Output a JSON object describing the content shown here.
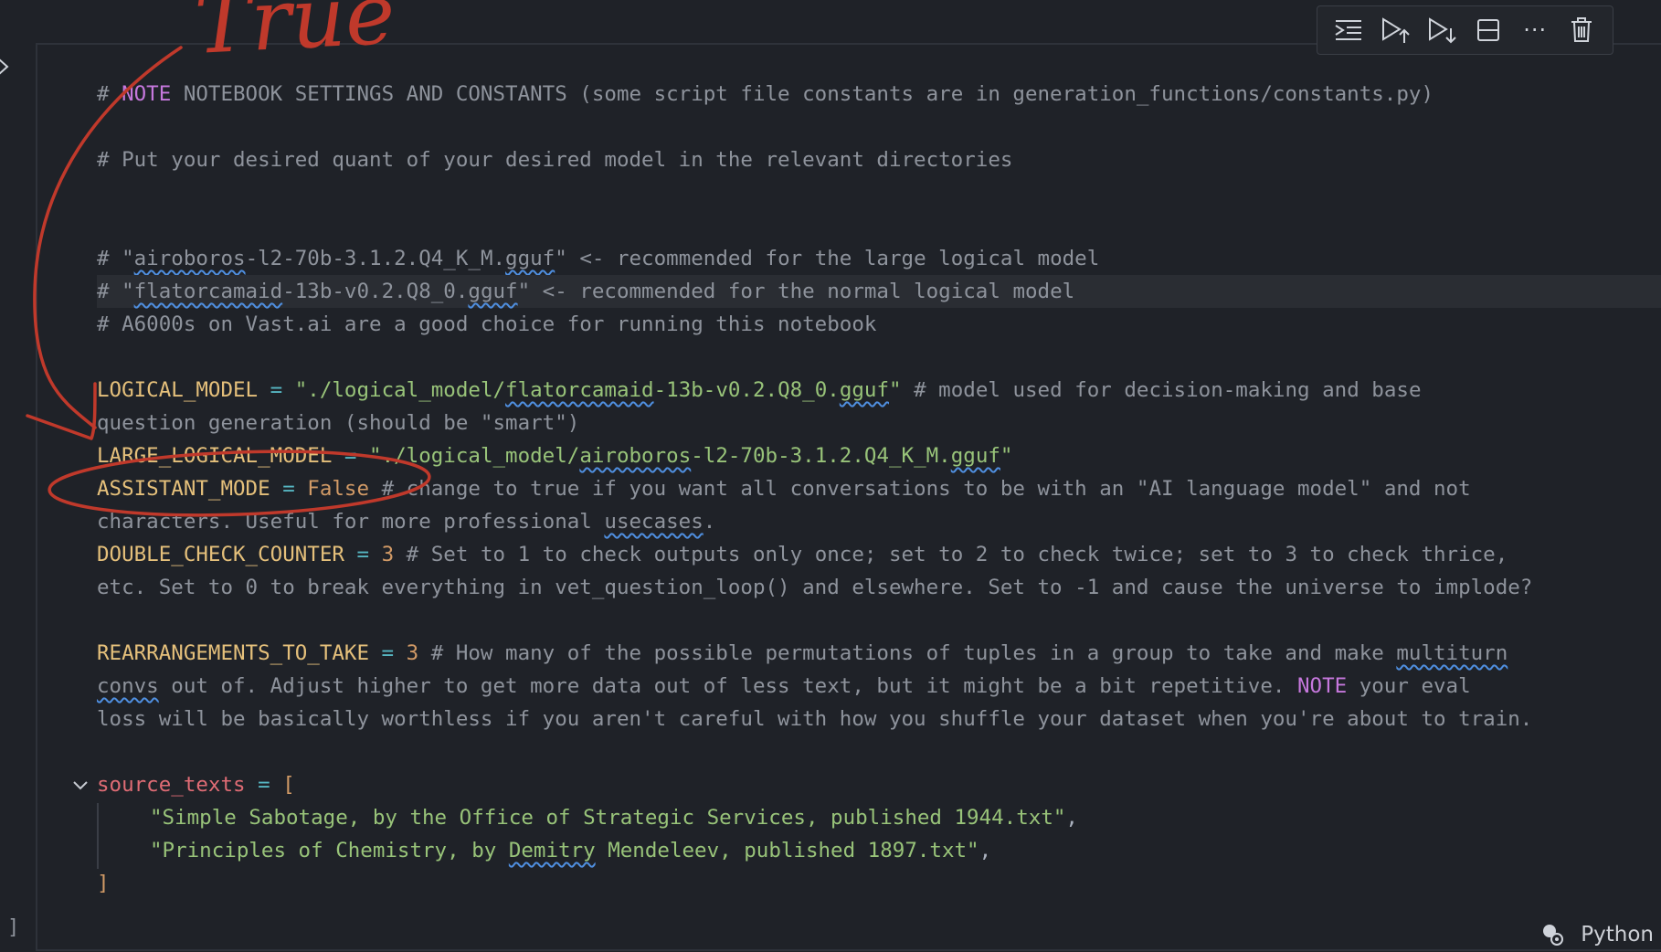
{
  "code": {
    "l1_hash": "# ",
    "l1_note": "NOTE",
    "l1_rest": " NOTEBOOK SETTINGS AND CONSTANTS (some script file constants are in generation_functions/constants.py)",
    "l2": "# Put your desired quant of your desired model in the relevant directories",
    "l3_a": "# \"",
    "l3_b": "airoboros",
    "l3_c": "-l2-70b-3.1.2.Q4_K_M.",
    "l3_d": "gguf",
    "l3_e": "\" <- recommended for the large logical model",
    "l4_a": "# \"",
    "l4_b": "flatorcamaid",
    "l4_c": "-13b-v0.2.Q8_0.",
    "l4_d": "gguf",
    "l4_e": "\" <- recommended for the normal logical model",
    "l5": "# A6000s on Vast.ai are a good choice for running this notebook",
    "l6_var": "LOGICAL_MODEL",
    "eq": " = ",
    "l6_s1": "\"./logical_model/",
    "l6_s2": "flatorcamaid",
    "l6_s3": "-13b-v0.2.Q8_0.",
    "l6_s4": "gguf",
    "l6_s5": "\"",
    "l6_cm": " # model used for decision-making and base",
    "l7_cm": "question generation (should be \"smart\")",
    "l8_var": "LARGE_LOGICAL_MODEL",
    "l8_s1": "\"./logical_model/",
    "l8_s2": "airoboros",
    "l8_s3": "-l2-70b-3.1.2.Q4_K_M.",
    "l8_s4": "gguf",
    "l8_s5": "\"",
    "l9_var": "ASSISTANT_MODE",
    "l9_val": "False",
    "l9_cm": " # change to true if you want all conversations to be with an \"AI language model\" and not",
    "l10_a": "characters. Useful for more professional ",
    "l10_b": "usecases",
    "l10_c": ".",
    "l11_var": "DOUBLE_CHECK_COUNTER",
    "l11_val": "3",
    "l11_cm": " # Set to 1 to check outputs only once; set to 2 to check twice; set to 3 to check thrice,",
    "l12_cm": "etc. Set to 0 to break everything in vet_question_loop() and elsewhere. Set to -1 and cause the universe to implode?",
    "l13_var": "REARRANGEMENTS_TO_TAKE",
    "l13_val": "3",
    "l13_cm": " # How many of the possible permutations of tuples in a group to take and make ",
    "l13_sq": "multiturn",
    "l14_sq": "convs",
    "l14_a": " out of. Adjust higher to get more data out of less text, but it might be a bit repetitive. ",
    "l14_note": "NOTE",
    "l14_b": " your eval",
    "l15": "loss will be basically worthless if you aren't careful with how you shuffle your dataset when you're about to train.",
    "l16_var": "source_texts",
    "l16_br": "[",
    "l17": "\"Simple Sabotage, by the Office of Strategic Services, published 1944.txt\"",
    "l17_comma": ",",
    "l18_a": "\"Principles of Chemistry, by ",
    "l18_b": "Demitry",
    "l18_c": " Mendeleev, published 1897.txt\"",
    "l18_comma": ",",
    "l19_br": "]"
  },
  "toolbar": {
    "icons": [
      "run-by-line-icon",
      "execute-above-icon",
      "execute-below-icon",
      "split-cell-icon",
      "more-icon",
      "delete-icon"
    ],
    "more_label": "···"
  },
  "status": {
    "kernel": "Python"
  },
  "annotation": {
    "handwritten": "True"
  },
  "gutter": {
    "bottom_bracket": "]"
  },
  "colors": {
    "background": "#1f2228",
    "comment": "#8e939c",
    "variable": "#e5c07b",
    "string": "#98c379",
    "number": "#d19a66",
    "keyword_note": "#c678dd",
    "annotation_red": "#c0392b"
  }
}
